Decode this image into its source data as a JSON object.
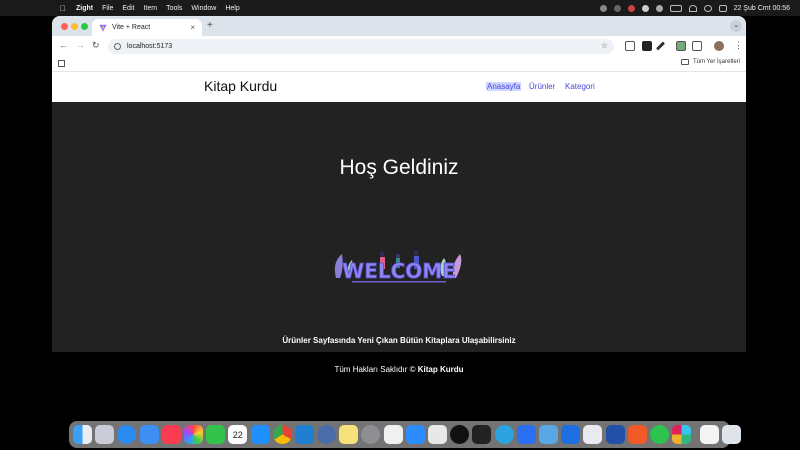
{
  "menubar": {
    "app_name": "Zight",
    "menus": [
      "File",
      "Edit",
      "Item",
      "Tools",
      "Window",
      "Help"
    ],
    "clock": "22 Şub Cmt  00:56"
  },
  "browser": {
    "tab_title": "Vite + React",
    "url": "localhost:5173",
    "bookmark_folder": "Tüm Yer İşaretleri"
  },
  "site": {
    "brand": "Kitap Kurdu",
    "nav": [
      "Anasayfa",
      "Ürünler",
      "Kategori"
    ],
    "hero_title": "Hoş Geldiniz",
    "welcome_art_text": "WELCOME",
    "subtitle": "Ürünler Sayfasında Yeni Çıkan Bütün Kitaplara Ulaşabilirsiniz",
    "footer_prefix": "Tüm Hakları Saklıdır ©",
    "footer_brand": "Kitap Kurdu"
  },
  "dock": {
    "apps": [
      "finder",
      "launchpad",
      "safari",
      "mail",
      "music",
      "photos",
      "facetime",
      "calendar",
      "app-store",
      "chrome",
      "vscode",
      "screen-sharing",
      "notes",
      "system-settings",
      "keynote",
      "zoom",
      "mongodb",
      "github",
      "terminal",
      "telegram",
      "video",
      "preview",
      "xcode",
      "authy",
      "instruments",
      "whatsapp",
      "slack",
      "textedit",
      "trash"
    ],
    "calendar_day": "22"
  }
}
